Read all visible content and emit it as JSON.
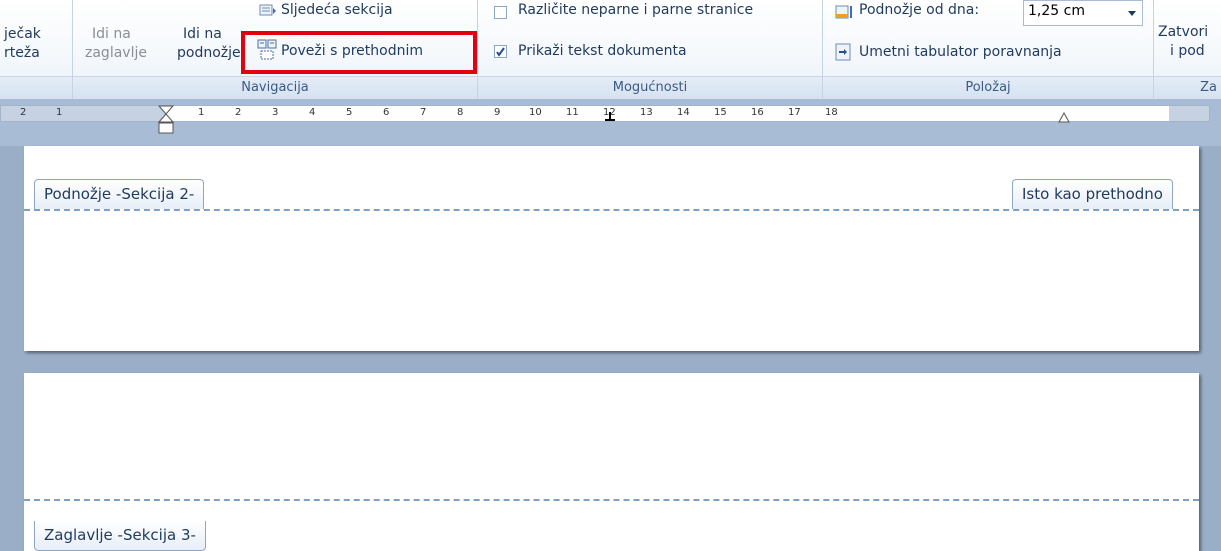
{
  "ribbon": {
    "left_clip": {
      "line1": "ječak",
      "line2": "rteža"
    },
    "nav_group": {
      "goto_header": {
        "line1": "Idi na",
        "line2": "zaglavlje"
      },
      "goto_footer": {
        "line1": "Idi na",
        "line2": "podnožje"
      },
      "next_section": "Sljedeća sekcija",
      "link_previous": "Poveži s prethodnim",
      "label": "Navigacija"
    },
    "options_group": {
      "different_odd_even": "Različite neparne i parne stranice",
      "show_document_text": "Prikaži tekst dokumenta",
      "label": "Mogućnosti"
    },
    "position_group": {
      "footer_from_bottom": "Podnožje od dna:",
      "footer_value": "1,25 cm",
      "insert_alignment_tab": "Umetni tabulator poravnanja",
      "label": "Položaj"
    },
    "close_group": {
      "line1": "Zatvori",
      "line2": "i pod",
      "label": "Za"
    }
  },
  "ruler": {
    "left_numbers": [
      "2",
      "1"
    ],
    "numbers": [
      "1",
      "2",
      "3",
      "4",
      "5",
      "6",
      "7",
      "8",
      "9",
      "10",
      "11",
      "12",
      "13",
      "14",
      "15",
      "16",
      "17",
      "18"
    ]
  },
  "page1": {
    "footer_tab": "Podnožje -Sekcija 2-",
    "same_as_previous": "Isto kao prethodno"
  },
  "page2": {
    "header_tab": "Zaglavlje -Sekcija 3-"
  },
  "colors": {
    "accent_highlight": "#e3000f",
    "ribbon_text": "#1f3a5f",
    "dashed_line": "#7f9fc9"
  }
}
